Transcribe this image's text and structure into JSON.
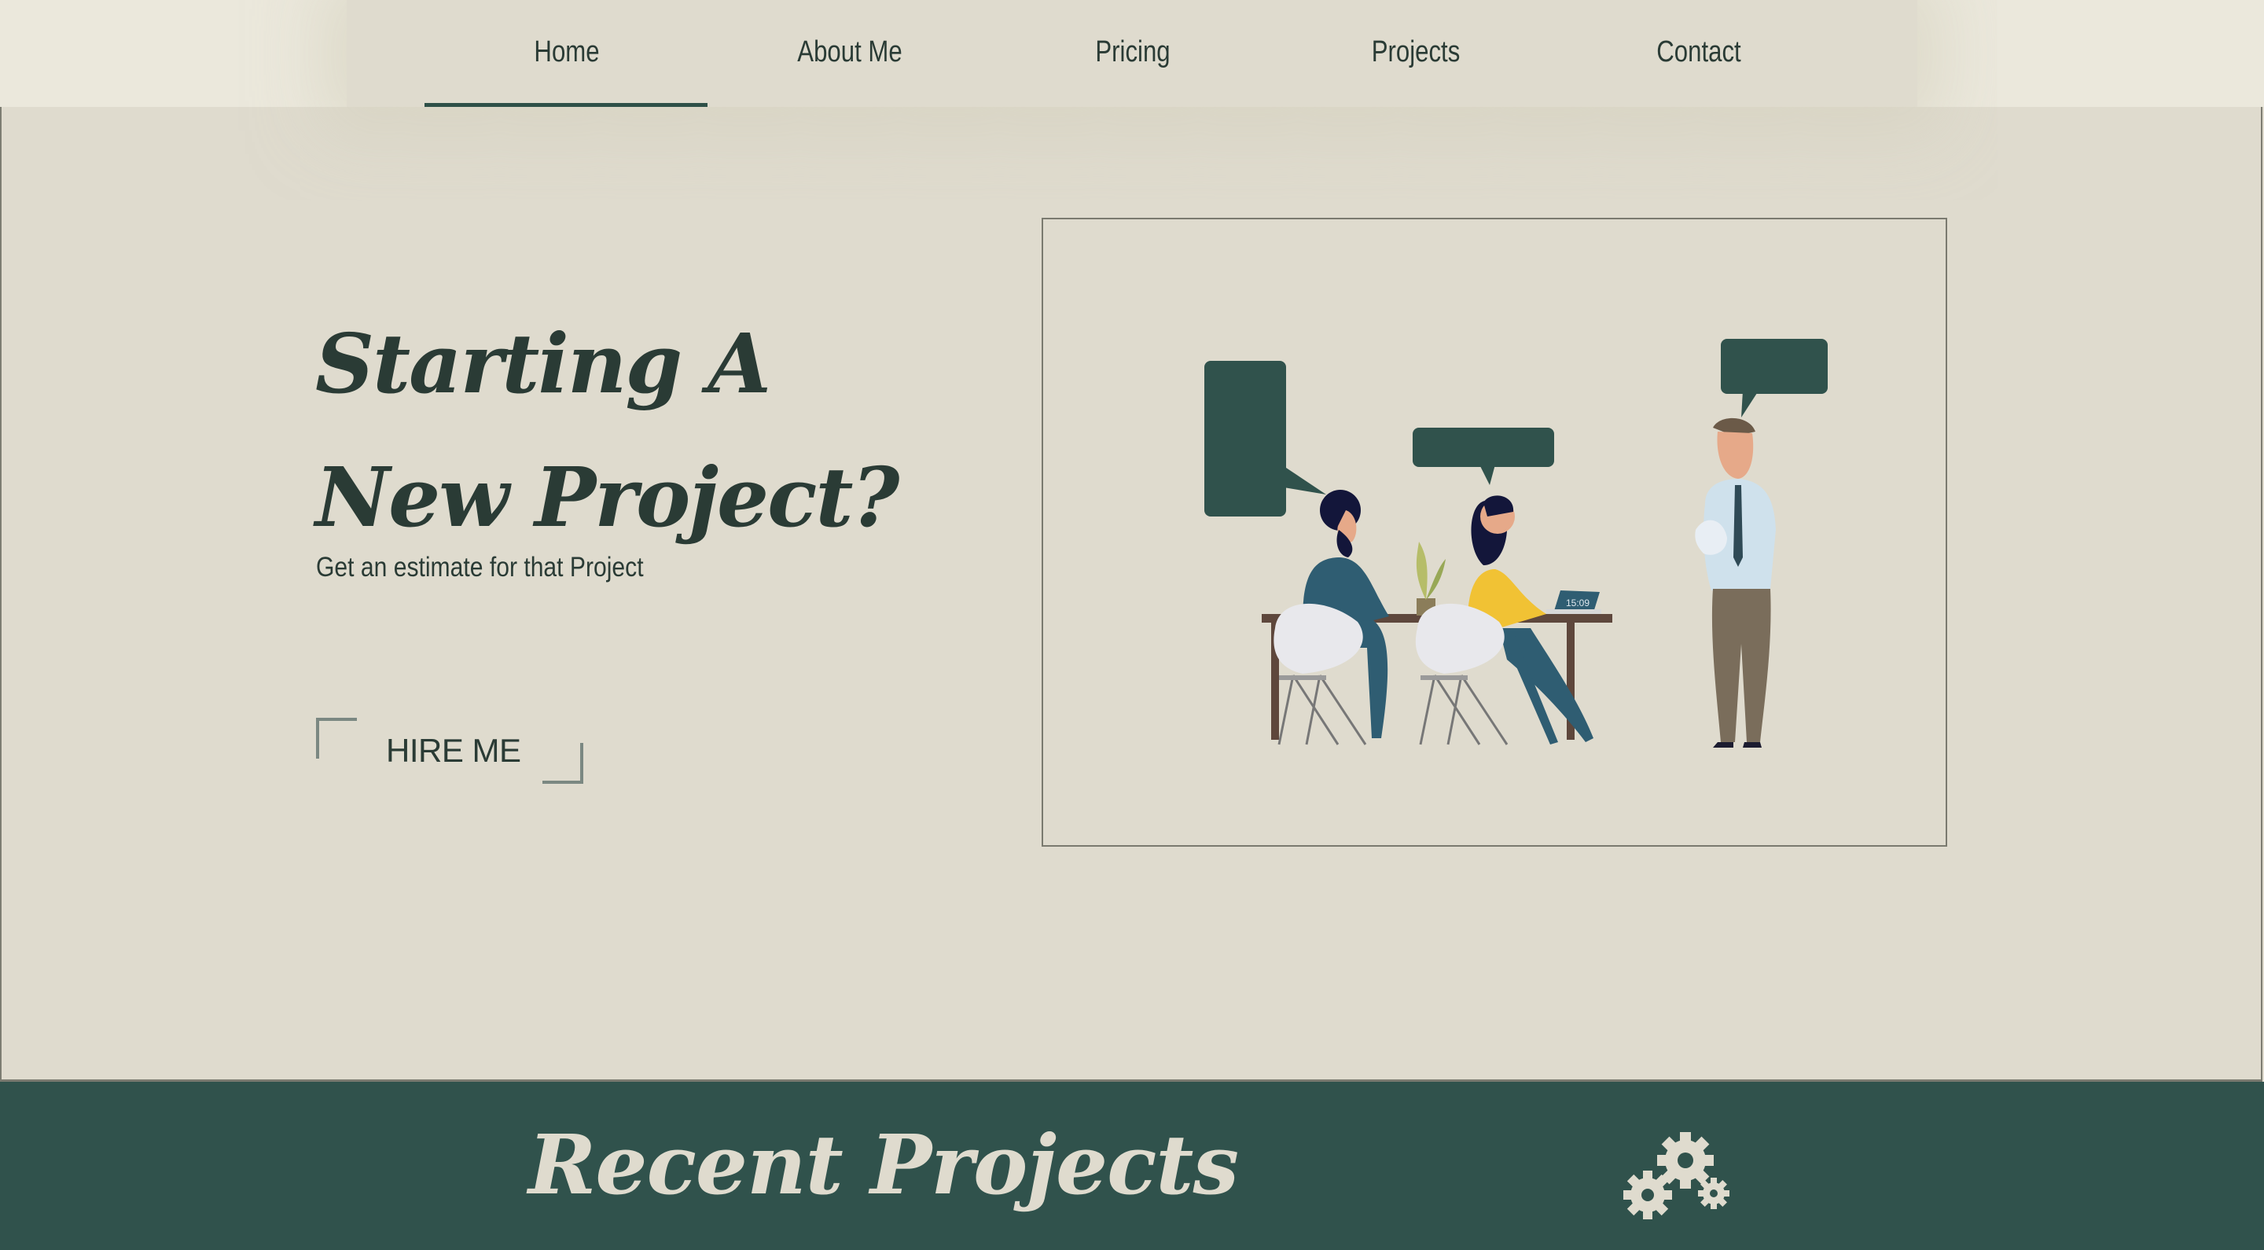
{
  "nav": {
    "items": [
      {
        "label": "Home",
        "active": true
      },
      {
        "label": "About Me"
      },
      {
        "label": "Pricing"
      },
      {
        "label": "Projects"
      },
      {
        "label": "Contact"
      }
    ]
  },
  "hero": {
    "headline_line1": "Starting A",
    "headline_line2": "New Project?",
    "subtitle": "Get an estimate for that Project",
    "cta_label": "HIRE ME",
    "illustration_clock": "15:09"
  },
  "recent": {
    "title": "Recent Projects"
  },
  "colors": {
    "background": "#dfdbce",
    "accent_dark_green": "#30524c",
    "text": "#2a3b35"
  },
  "icons": [
    "gears-icon"
  ]
}
